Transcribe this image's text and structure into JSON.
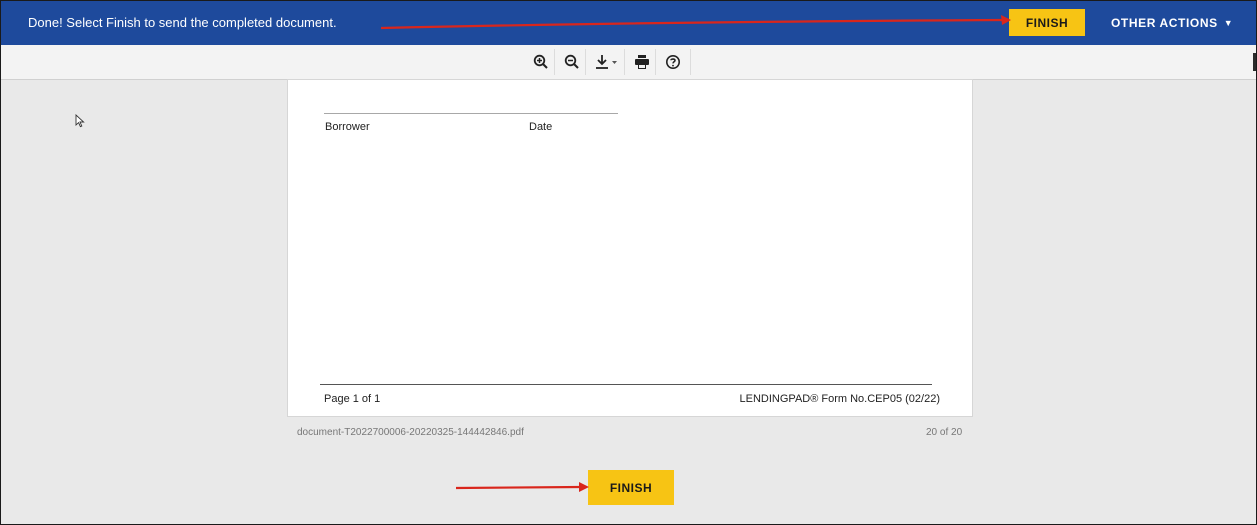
{
  "banner": {
    "message": "Done! Select Finish to send the completed document.",
    "finish_label": "FINISH",
    "other_actions_label": "OTHER ACTIONS",
    "bg_color": "#1e4a9c",
    "accent_color": "#f7c414"
  },
  "toolbar": {
    "tools": [
      {
        "name": "zoom-in-icon"
      },
      {
        "name": "zoom-out-icon"
      },
      {
        "name": "download-icon"
      },
      {
        "name": "print-icon"
      },
      {
        "name": "help-icon"
      }
    ]
  },
  "document": {
    "borrower_label": "Borrower",
    "date_label": "Date",
    "page_label": "Page 1 of 1",
    "form_number": "LENDINGPAD® Form No.CEP05 (02/22)",
    "filename": "document-T2022700006-20220325-144442846.pdf",
    "page_count": "20 of 20"
  },
  "bottom": {
    "finish_label": "FINISH"
  },
  "annotation_color": "#d9261c"
}
